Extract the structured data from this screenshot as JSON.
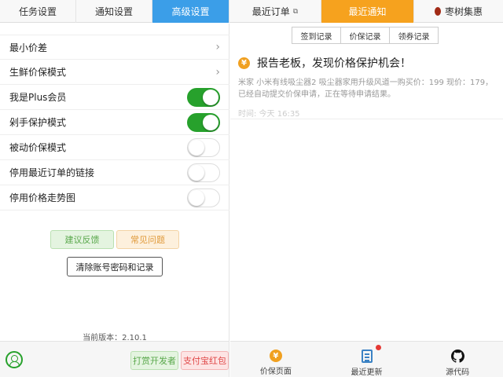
{
  "tabs": [
    {
      "label": "任务设置"
    },
    {
      "label": "通知设置"
    },
    {
      "label": "高级设置"
    },
    {
      "label": "最近订单"
    },
    {
      "label": "最近通知"
    },
    {
      "label": "枣树集惠"
    }
  ],
  "settings": {
    "rows": [
      {
        "label": "最小价差",
        "control": "chevron"
      },
      {
        "label": "生鲜价保模式",
        "control": "chevron"
      },
      {
        "label": "我是Plus会员",
        "control": "toggle",
        "on": true
      },
      {
        "label": "剁手保护模式",
        "control": "toggle",
        "on": true
      },
      {
        "label": "被动价保模式",
        "control": "toggle",
        "on": false
      },
      {
        "label": "停用最近订单的链接",
        "control": "toggle",
        "on": false
      },
      {
        "label": "停用价格走势图",
        "control": "toggle",
        "on": false
      }
    ],
    "feedback_label": "建议反馈",
    "faq_label": "常见问题",
    "clear_label": "清除账号密码和记录",
    "version": "当前版本：2.10.1"
  },
  "subtabs": [
    "签到记录",
    "价保记录",
    "领券记录"
  ],
  "notification": {
    "title": "报告老板，发现价格保护机会！",
    "body": "米家 小米有线吸尘器2 吸尘器家用升级风道一购买价：199 现价：179，已经自动提交价保申请，正在等待申请结果。",
    "time": "时间: 今天 16:35"
  },
  "bottom_left": {
    "donate_label": "打赏开发者",
    "alipay_label": "支付宝红包"
  },
  "bottom_nav": [
    {
      "label": "价保页面",
      "icon": "yen-icon"
    },
    {
      "label": "最近更新",
      "icon": "document-icon",
      "badge": true
    },
    {
      "label": "源代码",
      "icon": "github-icon"
    }
  ],
  "colors": {
    "blue_tab": "#3b9ee8",
    "orange_tab": "#f6a21e",
    "toggle_on": "#27a12c"
  }
}
